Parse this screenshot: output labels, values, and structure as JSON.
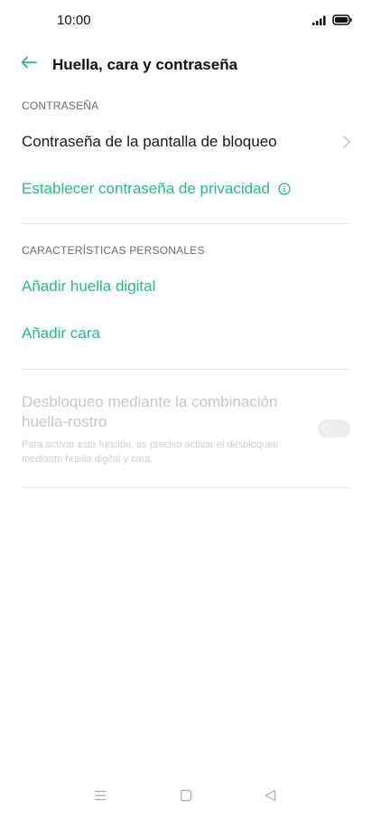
{
  "status_bar": {
    "time": "10:00",
    "signal_icon": "signal-icon",
    "battery_icon": "battery-icon"
  },
  "header": {
    "title": "Huella, cara y contraseña",
    "back_icon": "arrow-left-icon"
  },
  "sections": {
    "password": {
      "header": "CONTRASEÑA",
      "lock_screen_password": "Contraseña de la pantalla de bloqueo",
      "privacy_password": "Establecer contraseña de privacidad"
    },
    "personal": {
      "header": "CARACTERÍSTICAS PERSONALES",
      "add_fingerprint": "Añadir huella digital",
      "add_face": "Añadir cara"
    },
    "combo": {
      "title": "Desbloqueo mediante la combinación huella-rostro",
      "description": "Para activar esta función, es preciso activar el desbloqueo mediante huella digital y cara.",
      "enabled": false
    }
  },
  "colors": {
    "accent": "#22c07a",
    "disabled_text": "#c8c8c8"
  },
  "nav": {
    "menu_icon": "menu-icon",
    "home_icon": "home-icon",
    "back_icon": "back-triangle-icon"
  }
}
